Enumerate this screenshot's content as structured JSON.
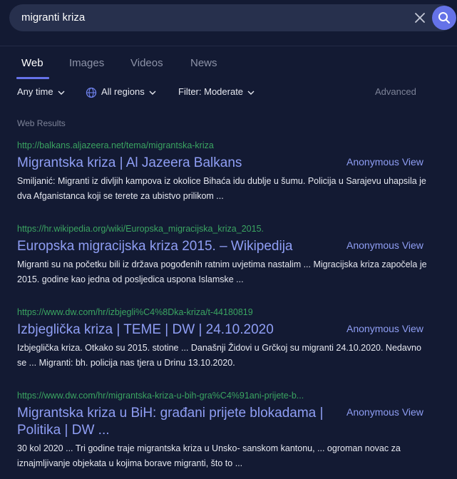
{
  "search": {
    "query": "migranti kriza"
  },
  "tabs": [
    {
      "label": "Web"
    },
    {
      "label": "Images"
    },
    {
      "label": "Videos"
    },
    {
      "label": "News"
    }
  ],
  "filters": {
    "time": "Any time",
    "region": "All regions",
    "safe": "Filter: Moderate",
    "advanced": "Advanced"
  },
  "section_label": "Web Results",
  "results": [
    {
      "url": "http://balkans.aljazeera.net/tema/migrantska-kriza",
      "title": "Migrantska kriza | Al Jazeera Balkans",
      "anon": "Anonymous View",
      "snippet": "Smiljanić: Migranti iz divljih kampova iz okolice Bihaća idu dublje u šumu. Policija u Sarajevu uhapsila je dva Afganistanca koji se terete za ubistvo prilikom ..."
    },
    {
      "url": "https://hr.wikipedia.org/wiki/Europska_migracijska_kriza_2015.",
      "title": "Europska migracijska kriza 2015. – Wikipedija",
      "anon": "Anonymous View",
      "snippet": "Migranti su na početku bili iz država pogođenih ratnim uvjetima nastalim ... Migracijska kriza započela je 2015. godine kao jedna od posljedica uspona Islamske ..."
    },
    {
      "url": "https://www.dw.com/hr/izbjegli%C4%8Dka-kriza/t-44180819",
      "title": "Izbjeglička kriza | TEME | DW | 24.10.2020",
      "anon": "Anonymous View",
      "snippet": "Izbjeglička kriza. Otkako su 2015. stotine ... Današnji Židovi u Grčkoj su migranti 24.10.2020. Nedavno se ... Migranti: bh. policija nas tjera u Drinu 13.10.2020."
    },
    {
      "url": "https://www.dw.com/hr/migrantska-kriza-u-bih-gra%C4%91ani-prijete-b...",
      "title": "Migrantska kriza u BiH: građani prijete blokadama | Politika | DW ...",
      "anon": "Anonymous View",
      "snippet": "30 kol 2020 ... Tri godine traje migrantska kriza u Unsko- sanskom kantonu, ... ogroman novac za iznajmljivanje objekata u kojima borave migranti, što to ..."
    }
  ],
  "colors": {
    "background": "#131a33",
    "search_bar": "#27304d",
    "accent": "#6572e8",
    "link_title": "#8f9ef4",
    "url_green": "#3aa461",
    "muted": "#7d8398"
  }
}
